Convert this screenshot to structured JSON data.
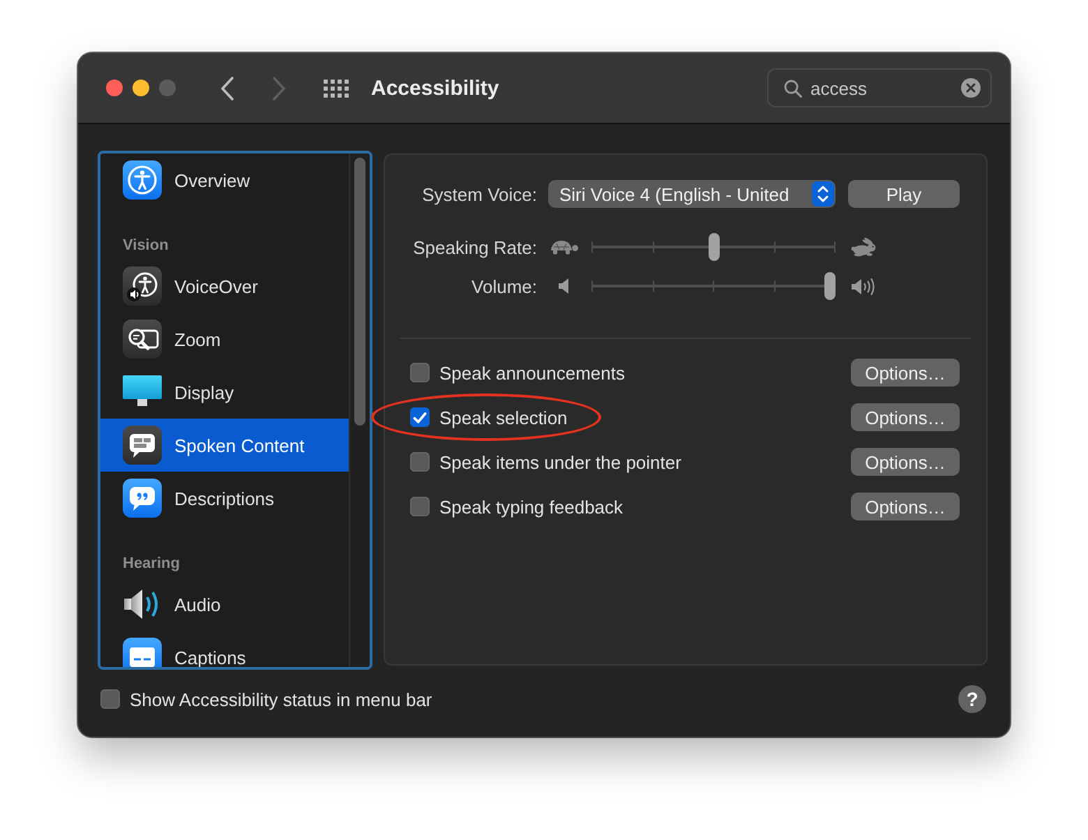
{
  "window": {
    "title": "Accessibility",
    "buttons": [
      {
        "kind": "close",
        "disabled": false
      },
      {
        "kind": "minimize",
        "disabled": false
      },
      {
        "kind": "zoom",
        "disabled": true
      }
    ]
  },
  "navigation": [
    {
      "kind": "back",
      "disabled": false
    },
    {
      "kind": "forward",
      "disabled": true
    }
  ],
  "search": {
    "value": "access"
  },
  "sidebar": {
    "groups": [
      {
        "items": [
          {
            "label": "Overview",
            "selected": false
          }
        ]
      },
      {
        "heading": "Vision",
        "items": [
          {
            "label": "VoiceOver",
            "selected": false
          },
          {
            "label": "Zoom",
            "selected": false
          },
          {
            "label": "Display",
            "selected": false
          },
          {
            "label": "Spoken Content",
            "selected": true
          },
          {
            "label": "Descriptions",
            "selected": false
          }
        ]
      },
      {
        "heading": "Hearing",
        "items": [
          {
            "label": "Audio",
            "selected": false
          },
          {
            "label": "Captions",
            "selected": false
          }
        ]
      }
    ]
  },
  "voice": {
    "label": "System Voice:",
    "value": "Siri Voice 4 (English - United",
    "play_button": "Play"
  },
  "sliders": [
    {
      "kind": "rate",
      "label": "Speaking Rate:",
      "level": 0.5
    },
    {
      "kind": "volume",
      "label": "Volume:",
      "level": 1
    }
  ],
  "options": [
    {
      "label": "Speak announcements",
      "checked": false,
      "circled": false,
      "button": "Options…"
    },
    {
      "label": "Speak selection",
      "checked": true,
      "circled": true,
      "button": "Options…"
    },
    {
      "label": "Speak items under the pointer",
      "checked": false,
      "circled": false,
      "button": "Options…"
    },
    {
      "label": "Speak typing feedback",
      "checked": false,
      "circled": false,
      "button": "Options…"
    }
  ],
  "footer": {
    "checkbox": {
      "label": "Show Accessibility status in menu bar",
      "checked": false
    },
    "help_button": "?"
  }
}
